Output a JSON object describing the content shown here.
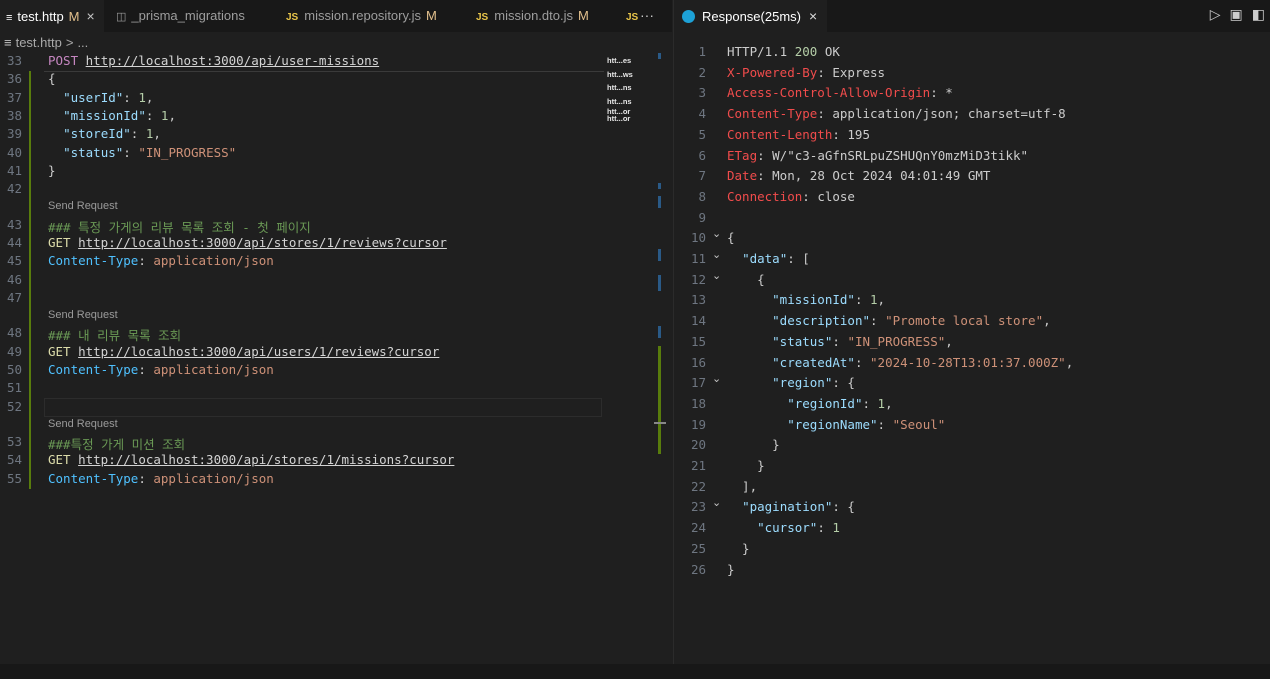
{
  "left_tabs": [
    {
      "label": "test.http",
      "modified": "M",
      "type": "http"
    },
    {
      "label": "_prisma_migrations",
      "type": "table"
    },
    {
      "label": "mission.repository.js",
      "modified": "M",
      "type": "js"
    },
    {
      "label": "mission.dto.js",
      "modified": "M",
      "type": "js"
    },
    {
      "label": "JS",
      "type": "js-partial"
    }
  ],
  "breadcrumb": {
    "file": "test.http",
    "sep": ">",
    "rest": "..."
  },
  "editor": {
    "codelens": "Send Request",
    "lines": [
      {
        "n": "33",
        "parts": [
          [
            "kw",
            "POST"
          ],
          [
            "plain",
            " "
          ],
          [
            "url",
            "http://localhost:3000/api/user-missions"
          ]
        ]
      },
      {
        "n": "36",
        "parts": [
          [
            "plain",
            "{"
          ]
        ]
      },
      {
        "n": "37",
        "parts": [
          [
            "plain",
            "  "
          ],
          [
            "key",
            "\"userId\""
          ],
          [
            "plain",
            ": "
          ],
          [
            "num",
            "1"
          ],
          [
            "plain",
            ","
          ]
        ]
      },
      {
        "n": "38",
        "parts": [
          [
            "plain",
            "  "
          ],
          [
            "key",
            "\"missionId\""
          ],
          [
            "plain",
            ": "
          ],
          [
            "num",
            "1"
          ],
          [
            "plain",
            ","
          ]
        ]
      },
      {
        "n": "39",
        "parts": [
          [
            "plain",
            "  "
          ],
          [
            "key",
            "\"storeId\""
          ],
          [
            "plain",
            ": "
          ],
          [
            "num",
            "1"
          ],
          [
            "plain",
            ","
          ]
        ]
      },
      {
        "n": "40",
        "parts": [
          [
            "plain",
            "  "
          ],
          [
            "key",
            "\"status\""
          ],
          [
            "plain",
            ": "
          ],
          [
            "str",
            "\"IN_PROGRESS\""
          ]
        ]
      },
      {
        "n": "41",
        "parts": [
          [
            "plain",
            "}"
          ]
        ]
      },
      {
        "n": "42",
        "parts": []
      },
      {
        "n": "43",
        "parts": [
          [
            "cmt",
            "### 특정 가게의 리뷰 목록 조회 - 첫 페이지"
          ]
        ],
        "codelens": true
      },
      {
        "n": "44",
        "parts": [
          [
            "mth",
            "GET"
          ],
          [
            "plain",
            " "
          ],
          [
            "url",
            "http://localhost:3000/api/stores/1/reviews?cursor"
          ]
        ]
      },
      {
        "n": "45",
        "parts": [
          [
            "hdr",
            "Content-Type"
          ],
          [
            "plain",
            ": "
          ],
          [
            "str",
            "application/json"
          ]
        ]
      },
      {
        "n": "46",
        "parts": []
      },
      {
        "n": "47",
        "parts": []
      },
      {
        "n": "48",
        "parts": [
          [
            "cmt",
            "### 내 리뷰 목록 조회"
          ]
        ],
        "codelens": true
      },
      {
        "n": "49",
        "parts": [
          [
            "mth",
            "GET"
          ],
          [
            "plain",
            " "
          ],
          [
            "url",
            "http://localhost:3000/api/users/1/reviews?cursor"
          ]
        ]
      },
      {
        "n": "50",
        "parts": [
          [
            "hdr",
            "Content-Type"
          ],
          [
            "plain",
            ": "
          ],
          [
            "str",
            "application/json"
          ]
        ]
      },
      {
        "n": "51",
        "parts": []
      },
      {
        "n": "52",
        "parts": []
      },
      {
        "n": "53",
        "parts": [
          [
            "cmt",
            "###특정 가게 미션 조회"
          ]
        ],
        "codelens": true
      },
      {
        "n": "54",
        "parts": [
          [
            "mth",
            "GET"
          ],
          [
            "plain",
            " "
          ],
          [
            "url",
            "http://localhost:3000/api/stores/1/missions?cursor"
          ]
        ]
      },
      {
        "n": "55",
        "parts": [
          [
            "hdr",
            "Content-Type"
          ],
          [
            "plain",
            ": "
          ],
          [
            "str",
            "application/json"
          ]
        ]
      }
    ]
  },
  "minimap": [
    "htt...es",
    "htt...ws",
    "htt...ns",
    "htt...ns",
    "htt...or",
    "htt...or"
  ],
  "response_tab": {
    "label": "Response(25ms)",
    "icon": "rest-icon"
  },
  "response": {
    "lines": [
      {
        "n": "1",
        "fold": "",
        "parts": [
          [
            "rhv",
            "HTTP/1.1 "
          ],
          [
            "num",
            "200"
          ],
          [
            "rhv",
            " OK"
          ]
        ]
      },
      {
        "n": "2",
        "fold": "",
        "parts": [
          [
            "rhk",
            "X-Powered-By"
          ],
          [
            "rhv",
            ": Express"
          ]
        ]
      },
      {
        "n": "3",
        "fold": "",
        "parts": [
          [
            "rhk",
            "Access-Control-Allow-Origin"
          ],
          [
            "rhv",
            ": *"
          ]
        ]
      },
      {
        "n": "4",
        "fold": "",
        "parts": [
          [
            "rhk",
            "Content-Type"
          ],
          [
            "rhv",
            ": application/json; charset=utf-8"
          ]
        ]
      },
      {
        "n": "5",
        "fold": "",
        "parts": [
          [
            "rhk",
            "Content-Length"
          ],
          [
            "rhv",
            ": 195"
          ]
        ]
      },
      {
        "n": "6",
        "fold": "",
        "parts": [
          [
            "rhk",
            "ETag"
          ],
          [
            "rhv",
            ": W/\"c3-aGfnSRLpuZSHUQnY0mzMiD3tikk\""
          ]
        ]
      },
      {
        "n": "7",
        "fold": "",
        "parts": [
          [
            "rhk",
            "Date"
          ],
          [
            "rhv",
            ": Mon, 28 Oct 2024 04:01:49 GMT"
          ]
        ]
      },
      {
        "n": "8",
        "fold": "",
        "parts": [
          [
            "rhk",
            "Connection"
          ],
          [
            "rhv",
            ": close"
          ]
        ]
      },
      {
        "n": "9",
        "fold": "",
        "parts": []
      },
      {
        "n": "10",
        "fold": "⌄",
        "parts": [
          [
            "plain",
            "{"
          ]
        ]
      },
      {
        "n": "11",
        "fold": "⌄",
        "parts": [
          [
            "plain",
            "  "
          ],
          [
            "key",
            "\"data\""
          ],
          [
            "plain",
            ": ["
          ]
        ]
      },
      {
        "n": "12",
        "fold": "⌄",
        "parts": [
          [
            "plain",
            "    {"
          ]
        ]
      },
      {
        "n": "13",
        "fold": "",
        "parts": [
          [
            "plain",
            "      "
          ],
          [
            "key",
            "\"missionId\""
          ],
          [
            "plain",
            ": "
          ],
          [
            "num",
            "1"
          ],
          [
            "plain",
            ","
          ]
        ]
      },
      {
        "n": "14",
        "fold": "",
        "parts": [
          [
            "plain",
            "      "
          ],
          [
            "key",
            "\"description\""
          ],
          [
            "plain",
            ": "
          ],
          [
            "str",
            "\"Promote local store\""
          ],
          [
            "plain",
            ","
          ]
        ]
      },
      {
        "n": "15",
        "fold": "",
        "parts": [
          [
            "plain",
            "      "
          ],
          [
            "key",
            "\"status\""
          ],
          [
            "plain",
            ": "
          ],
          [
            "str",
            "\"IN_PROGRESS\""
          ],
          [
            "plain",
            ","
          ]
        ]
      },
      {
        "n": "16",
        "fold": "",
        "parts": [
          [
            "plain",
            "      "
          ],
          [
            "key",
            "\"createdAt\""
          ],
          [
            "plain",
            ": "
          ],
          [
            "str",
            "\"2024-10-28T13:01:37.000Z\""
          ],
          [
            "plain",
            ","
          ]
        ]
      },
      {
        "n": "17",
        "fold": "⌄",
        "parts": [
          [
            "plain",
            "      "
          ],
          [
            "key",
            "\"region\""
          ],
          [
            "plain",
            ": {"
          ]
        ]
      },
      {
        "n": "18",
        "fold": "",
        "parts": [
          [
            "plain",
            "        "
          ],
          [
            "key",
            "\"regionId\""
          ],
          [
            "plain",
            ": "
          ],
          [
            "num",
            "1"
          ],
          [
            "plain",
            ","
          ]
        ]
      },
      {
        "n": "19",
        "fold": "",
        "parts": [
          [
            "plain",
            "        "
          ],
          [
            "key",
            "\"regionName\""
          ],
          [
            "plain",
            ": "
          ],
          [
            "str",
            "\"Seoul\""
          ]
        ]
      },
      {
        "n": "20",
        "fold": "",
        "parts": [
          [
            "plain",
            "      }"
          ]
        ]
      },
      {
        "n": "21",
        "fold": "",
        "parts": [
          [
            "plain",
            "    }"
          ]
        ]
      },
      {
        "n": "22",
        "fold": "",
        "parts": [
          [
            "plain",
            "  ],"
          ]
        ]
      },
      {
        "n": "23",
        "fold": "⌄",
        "parts": [
          [
            "plain",
            "  "
          ],
          [
            "key",
            "\"pagination\""
          ],
          [
            "plain",
            ": {"
          ]
        ]
      },
      {
        "n": "24",
        "fold": "",
        "parts": [
          [
            "plain",
            "    "
          ],
          [
            "key",
            "\"cursor\""
          ],
          [
            "plain",
            ": "
          ],
          [
            "num",
            "1"
          ]
        ]
      },
      {
        "n": "25",
        "fold": "",
        "parts": [
          [
            "plain",
            "  }"
          ]
        ]
      },
      {
        "n": "26",
        "fold": "",
        "parts": [
          [
            "plain",
            "}"
          ]
        ]
      }
    ]
  },
  "colors": {
    "bg": "#1f1f1f",
    "tabbar": "#181818",
    "gutter_added": "#587c0c",
    "header_key": "#f14c4c"
  }
}
